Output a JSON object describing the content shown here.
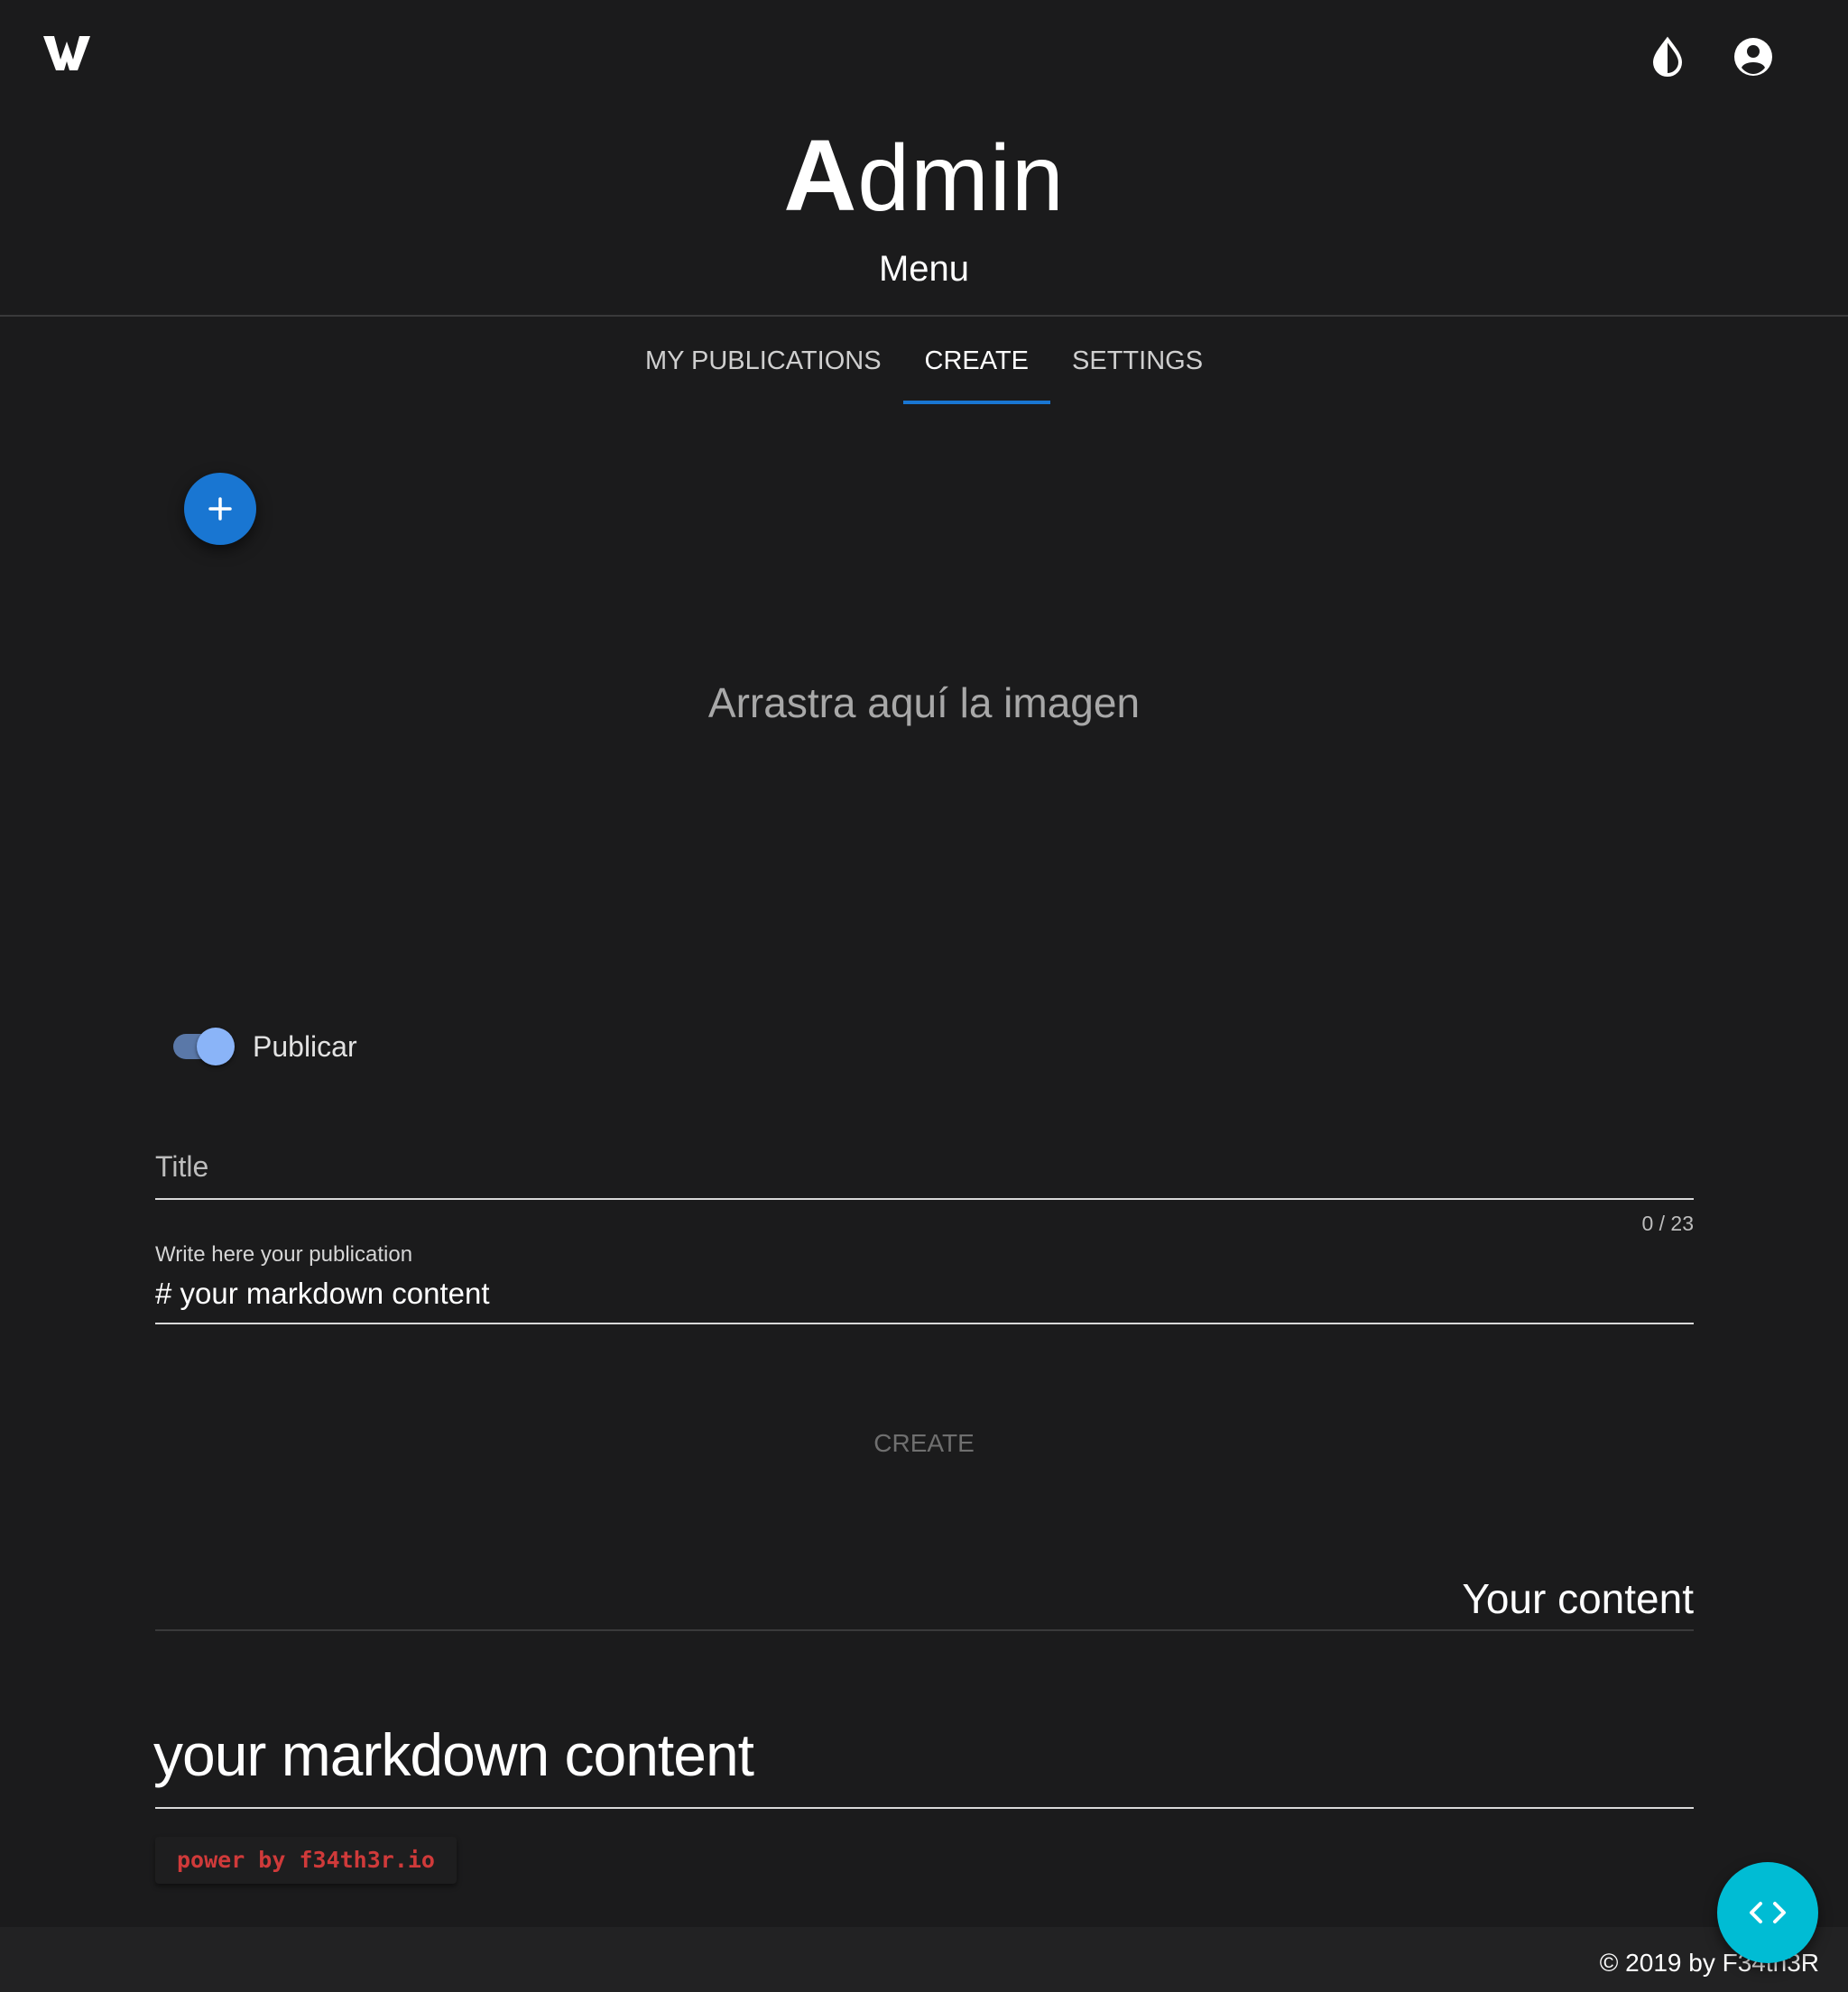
{
  "header": {
    "title_initial": "A",
    "title_rest": "dmin",
    "subtitle": "Menu"
  },
  "tabs": [
    {
      "label": "MY PUBLICATIONS",
      "active": false
    },
    {
      "label": "CREATE",
      "active": true
    },
    {
      "label": "SETTINGS",
      "active": false
    }
  ],
  "icons": {
    "logo": "w-logo-icon",
    "theme": "contrast-icon",
    "account": "account-circle-icon",
    "add": "plus-icon",
    "code": "code-brackets-icon"
  },
  "dropzone": {
    "text": "Arrastra aquí la imagen"
  },
  "publish_toggle": {
    "label": "Publicar",
    "checked": true
  },
  "form": {
    "title_placeholder": "Title",
    "title_counter": "0 / 23",
    "content_label": "Write here your publication",
    "content_value": "# your markdown content",
    "create_button": "CREATE"
  },
  "preview": {
    "heading": "Your content",
    "h1": "your markdown content",
    "code": "power by f34th3r.io"
  },
  "footer": {
    "text": "© 2019 by F34th3R"
  },
  "colors": {
    "background": "#1b1b1c",
    "accent": "#1976d2",
    "fab_code": "#00bcd4",
    "code_text": "#d03a3a",
    "toggle_thumb": "#8ab4f8"
  }
}
